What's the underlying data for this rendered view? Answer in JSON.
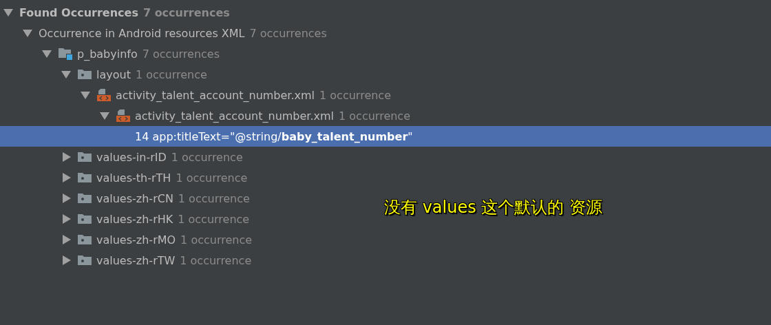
{
  "tree": [
    {
      "kind": "root",
      "label": "Found Occurrences",
      "count": "7 occurrences",
      "expanded": true,
      "selected": false,
      "children": [
        {
          "kind": "group",
          "label": "Occurrence in Android resources XML",
          "count": "7 occurrences",
          "expanded": true,
          "selected": false,
          "children": [
            {
              "kind": "module",
              "label": "p_babyinfo",
              "count": "7 occurrences",
              "expanded": true,
              "selected": false,
              "children": [
                {
                  "kind": "folder",
                  "label": "layout",
                  "count": "1 occurrence",
                  "expanded": true,
                  "selected": false,
                  "children": [
                    {
                      "kind": "file",
                      "label": "activity_talent_account_number.xml",
                      "count": "1 occurrence",
                      "expanded": true,
                      "selected": false,
                      "children": [
                        {
                          "kind": "file",
                          "label": "activity_talent_account_number.xml",
                          "count": "1 occurrence",
                          "expanded": true,
                          "selected": false,
                          "children": [
                            {
                              "kind": "usage",
                              "label": "14 app:titleText=\"@string/**baby_talent_number**\"",
                              "selected": true
                            }
                          ]
                        }
                      ]
                    }
                  ]
                },
                {
                  "kind": "folder",
                  "label": "values-in-rID",
                  "count": "1 occurrence",
                  "expanded": false,
                  "selected": false
                },
                {
                  "kind": "folder",
                  "label": "values-th-rTH",
                  "count": "1 occurrence",
                  "expanded": false,
                  "selected": false
                },
                {
                  "kind": "folder",
                  "label": "values-zh-rCN",
                  "count": "1 occurrence",
                  "expanded": false,
                  "selected": false
                },
                {
                  "kind": "folder",
                  "label": "values-zh-rHK",
                  "count": "1 occurrence",
                  "expanded": false,
                  "selected": false
                },
                {
                  "kind": "folder",
                  "label": "values-zh-rMO",
                  "count": "1 occurrence",
                  "expanded": false,
                  "selected": false
                },
                {
                  "kind": "folder",
                  "label": "values-zh-rTW",
                  "count": "1 occurrence",
                  "expanded": false,
                  "selected": false
                }
              ]
            }
          ]
        }
      ]
    }
  ],
  "annotation": "没有 values 这个默认的  资源"
}
